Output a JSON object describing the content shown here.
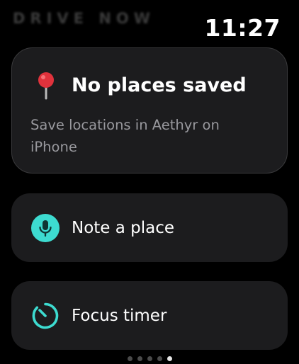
{
  "header": {
    "faded_title": "DRIVE NOW",
    "time": "11:27"
  },
  "places_card": {
    "icon": "pin-icon",
    "title": "No places saved",
    "subtitle": "Save locations in Aethyr on iPhone"
  },
  "actions": [
    {
      "label": "Note a place",
      "icon": "microphone-icon"
    },
    {
      "label": "Focus timer",
      "icon": "timer-icon"
    }
  ],
  "pager": {
    "count": 5,
    "active_index": 4
  },
  "colors": {
    "accent": "#3ddbd0",
    "pin": "#e0323c",
    "card_bg": "#1c1c1e",
    "subtext": "#98989d"
  }
}
